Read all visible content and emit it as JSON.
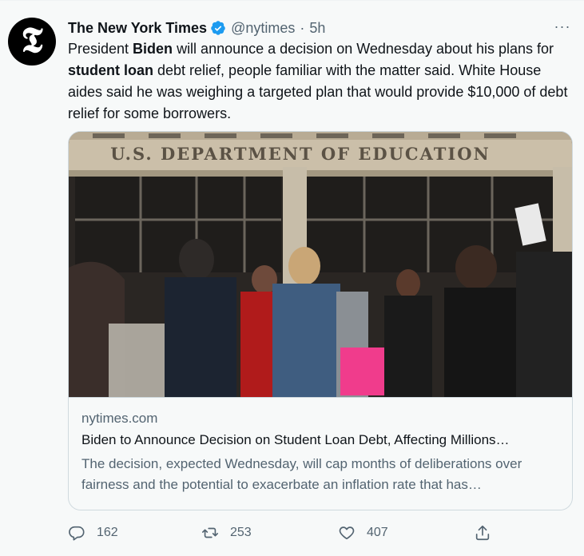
{
  "tweet": {
    "author_name": "The New York Times",
    "handle": "@nytimes",
    "separator": "·",
    "time": "5h",
    "more_label": "···",
    "avatar_glyph": "𝕿",
    "text_parts": {
      "p1": "President ",
      "b1": "Biden",
      "p2": " will announce a decision on Wednesday about his plans for ",
      "b2": "student loan",
      "p3": " debt relief, people familiar with the matter said. White House aides said he was weighing a targeted plan that would provide $10,000 of debt relief for some borrowers."
    }
  },
  "card": {
    "image_sign_text": "U.S. DEPARTMENT OF EDUCATION",
    "domain": "nytimes.com",
    "title": "Biden to Announce Decision on Student Loan Debt, Affecting Millions…",
    "description": "The decision, expected Wednesday, will cap months of deliberations over fairness and the potential to exacerbate an inflation rate that has…"
  },
  "actions": {
    "reply_count": "162",
    "retweet_count": "253",
    "like_count": "407"
  },
  "icons": {
    "verified": "verified-badge-icon",
    "reply": "reply-icon",
    "retweet": "retweet-icon",
    "like": "heart-icon",
    "share": "share-icon"
  },
  "colors": {
    "verified": "#1d9bf0",
    "muted": "#536471",
    "text": "#0f1419",
    "background": "#f7f9f9"
  }
}
